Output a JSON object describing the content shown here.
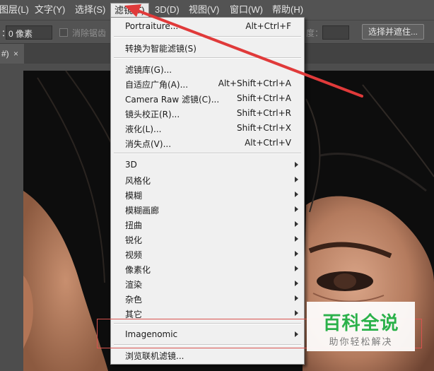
{
  "menubar": {
    "items": [
      {
        "label": "图层(L)"
      },
      {
        "label": "文字(Y)"
      },
      {
        "label": "选择(S)"
      },
      {
        "label": "滤镜(T)"
      },
      {
        "label": "3D(D)"
      },
      {
        "label": "视图(V)"
      },
      {
        "label": "窗口(W)"
      },
      {
        "label": "帮助(H)"
      }
    ]
  },
  "options": {
    "feather_label": "：",
    "feather_value": "0 像素",
    "antialias_label": "消除锯齿",
    "degree_label": "度：",
    "select_mask_button": "选择并遮住..."
  },
  "tab": {
    "label": "#)",
    "close": "×"
  },
  "filter_menu": {
    "items": [
      {
        "label": "Portraiture...",
        "shortcut": "Alt+Ctrl+F"
      },
      {
        "label": "转换为智能滤镜(S)",
        "shortcut": ""
      },
      {
        "label": "滤镜库(G)...",
        "shortcut": ""
      },
      {
        "label": "自适应广角(A)...",
        "shortcut": "Alt+Shift+Ctrl+A"
      },
      {
        "label": "Camera Raw 滤镜(C)...",
        "shortcut": "Shift+Ctrl+A"
      },
      {
        "label": "镜头校正(R)...",
        "shortcut": "Shift+Ctrl+R"
      },
      {
        "label": "液化(L)...",
        "shortcut": "Shift+Ctrl+X"
      },
      {
        "label": "消失点(V)...",
        "shortcut": "Alt+Ctrl+V"
      },
      {
        "label": "3D"
      },
      {
        "label": "风格化"
      },
      {
        "label": "模糊"
      },
      {
        "label": "模糊画廊"
      },
      {
        "label": "扭曲"
      },
      {
        "label": "锐化"
      },
      {
        "label": "视频"
      },
      {
        "label": "像素化"
      },
      {
        "label": "渲染"
      },
      {
        "label": "杂色"
      },
      {
        "label": "其它"
      },
      {
        "label": "Imagenomic"
      },
      {
        "label": "浏览联机滤镜..."
      }
    ]
  },
  "watermark": {
    "title": "百科全说",
    "subtitle": "助你轻松解决"
  },
  "colors": {
    "annotation_red": "#e03a3a",
    "watermark_green": "#2bb14a"
  }
}
